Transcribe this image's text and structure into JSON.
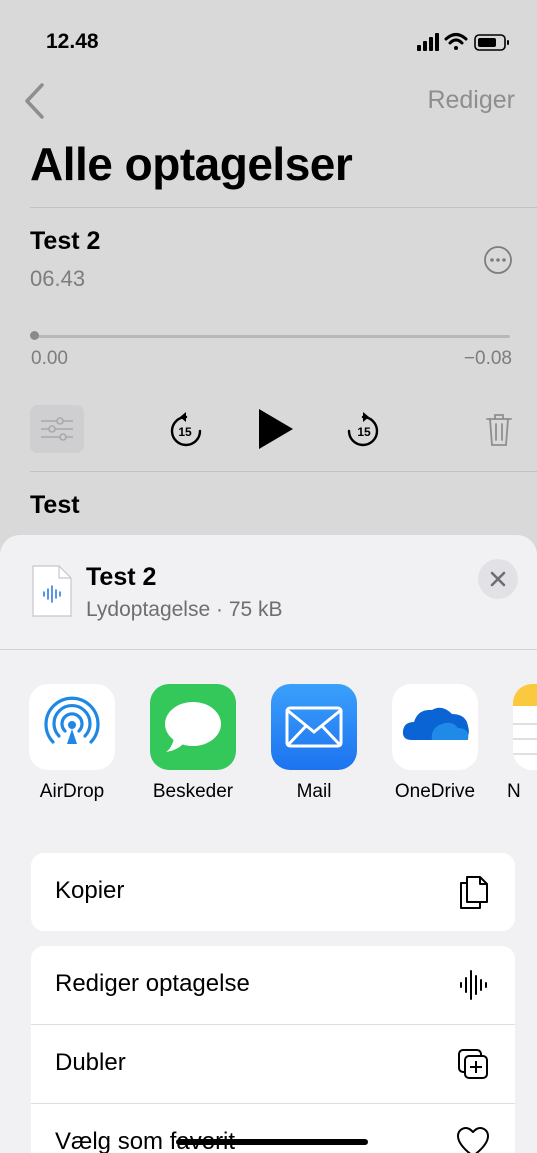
{
  "status": {
    "time": "12.48"
  },
  "nav": {
    "edit": "Rediger"
  },
  "page": {
    "title": "Alle optagelser"
  },
  "recording": {
    "title": "Test 2",
    "time": "06.43",
    "elapsed": "0.00",
    "remaining": "−0.08",
    "progress": 0.0
  },
  "recording2": {
    "title": "Test"
  },
  "share": {
    "file_name": "Test 2",
    "file_sub": "Lydoptagelse · 75 kB",
    "apps": [
      {
        "label": "AirDrop",
        "icon": "airdrop-icon"
      },
      {
        "label": "Beskeder",
        "icon": "messages-icon"
      },
      {
        "label": "Mail",
        "icon": "mail-icon"
      },
      {
        "label": "OneDrive",
        "icon": "onedrive-icon"
      },
      {
        "label": "N",
        "icon": "notes-icon"
      }
    ],
    "actions1": [
      {
        "label": "Kopier",
        "icon": "copy-icon"
      }
    ],
    "actions2": [
      {
        "label": "Rediger optagelse",
        "icon": "waveform-icon"
      },
      {
        "label": "Dubler",
        "icon": "duplicate-icon"
      },
      {
        "label": "Vælg som favorit",
        "icon": "heart-icon"
      }
    ]
  },
  "colors": {
    "mail": "#2a8ff7",
    "messages": "#34c759",
    "airdrop": "#1e88e5",
    "onedrive": "#0a64d4"
  }
}
